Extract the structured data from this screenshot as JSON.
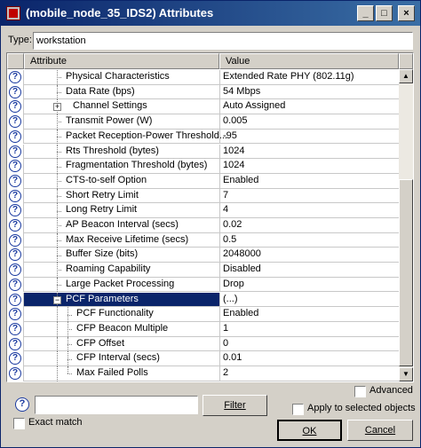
{
  "window": {
    "title": "(mobile_node_35_IDS2) Attributes",
    "minimize_glyph": "_",
    "maximize_glyph": "□",
    "close_glyph": "×"
  },
  "type_field": {
    "label": "Type:",
    "value": "workstation"
  },
  "grid": {
    "col_attribute": "Attribute",
    "col_value": "Value",
    "help_glyph": "?",
    "rows": [
      {
        "attr": "Physical Characteristics",
        "value": "Extended Rate PHY (802.11g)"
      },
      {
        "attr": "Data Rate (bps)",
        "value": "54 Mbps"
      },
      {
        "attr": "Channel Settings",
        "value": "Auto Assigned"
      },
      {
        "attr": "Transmit Power (W)",
        "value": "0.005"
      },
      {
        "attr": "Packet Reception-Power Threshold...",
        "value": "-95"
      },
      {
        "attr": "Rts Threshold (bytes)",
        "value": "1024"
      },
      {
        "attr": "Fragmentation Threshold (bytes)",
        "value": "1024"
      },
      {
        "attr": "CTS-to-self Option",
        "value": "Enabled"
      },
      {
        "attr": "Short Retry Limit",
        "value": "7"
      },
      {
        "attr": "Long Retry Limit",
        "value": "4"
      },
      {
        "attr": "AP Beacon Interval (secs)",
        "value": "0.02"
      },
      {
        "attr": "Max Receive Lifetime (secs)",
        "value": "0.5"
      },
      {
        "attr": "Buffer Size (bits)",
        "value": "2048000"
      },
      {
        "attr": "Roaming Capability",
        "value": "Disabled"
      },
      {
        "attr": "Large Packet Processing",
        "value": "Drop"
      },
      {
        "attr": "PCF Parameters",
        "value": "(...)"
      },
      {
        "attr": "PCF Functionality",
        "value": "Enabled"
      },
      {
        "attr": "CFP Beacon Multiple",
        "value": "1"
      },
      {
        "attr": "CFP Offset",
        "value": "0"
      },
      {
        "attr": "CFP Interval (secs)",
        "value": "0.01"
      },
      {
        "attr": "Max Failed Polls",
        "value": "2"
      }
    ],
    "expand_glyph": "+",
    "collapse_glyph": "−",
    "scroll_up_glyph": "▲",
    "scroll_down_glyph": "▼"
  },
  "bottom": {
    "help_glyph": "?",
    "filter_value": "",
    "filter_button": "Filter",
    "exact_match_label": "Exact match",
    "advanced_label": "Advanced",
    "apply_label": "Apply to selected objects",
    "ok_label": "OK",
    "cancel_label": "Cancel"
  },
  "colors": {
    "selection": "#0a246a",
    "titlebar_start": "#0a246a",
    "titlebar_end": "#3a6ea5",
    "face": "#d4d0c8"
  }
}
